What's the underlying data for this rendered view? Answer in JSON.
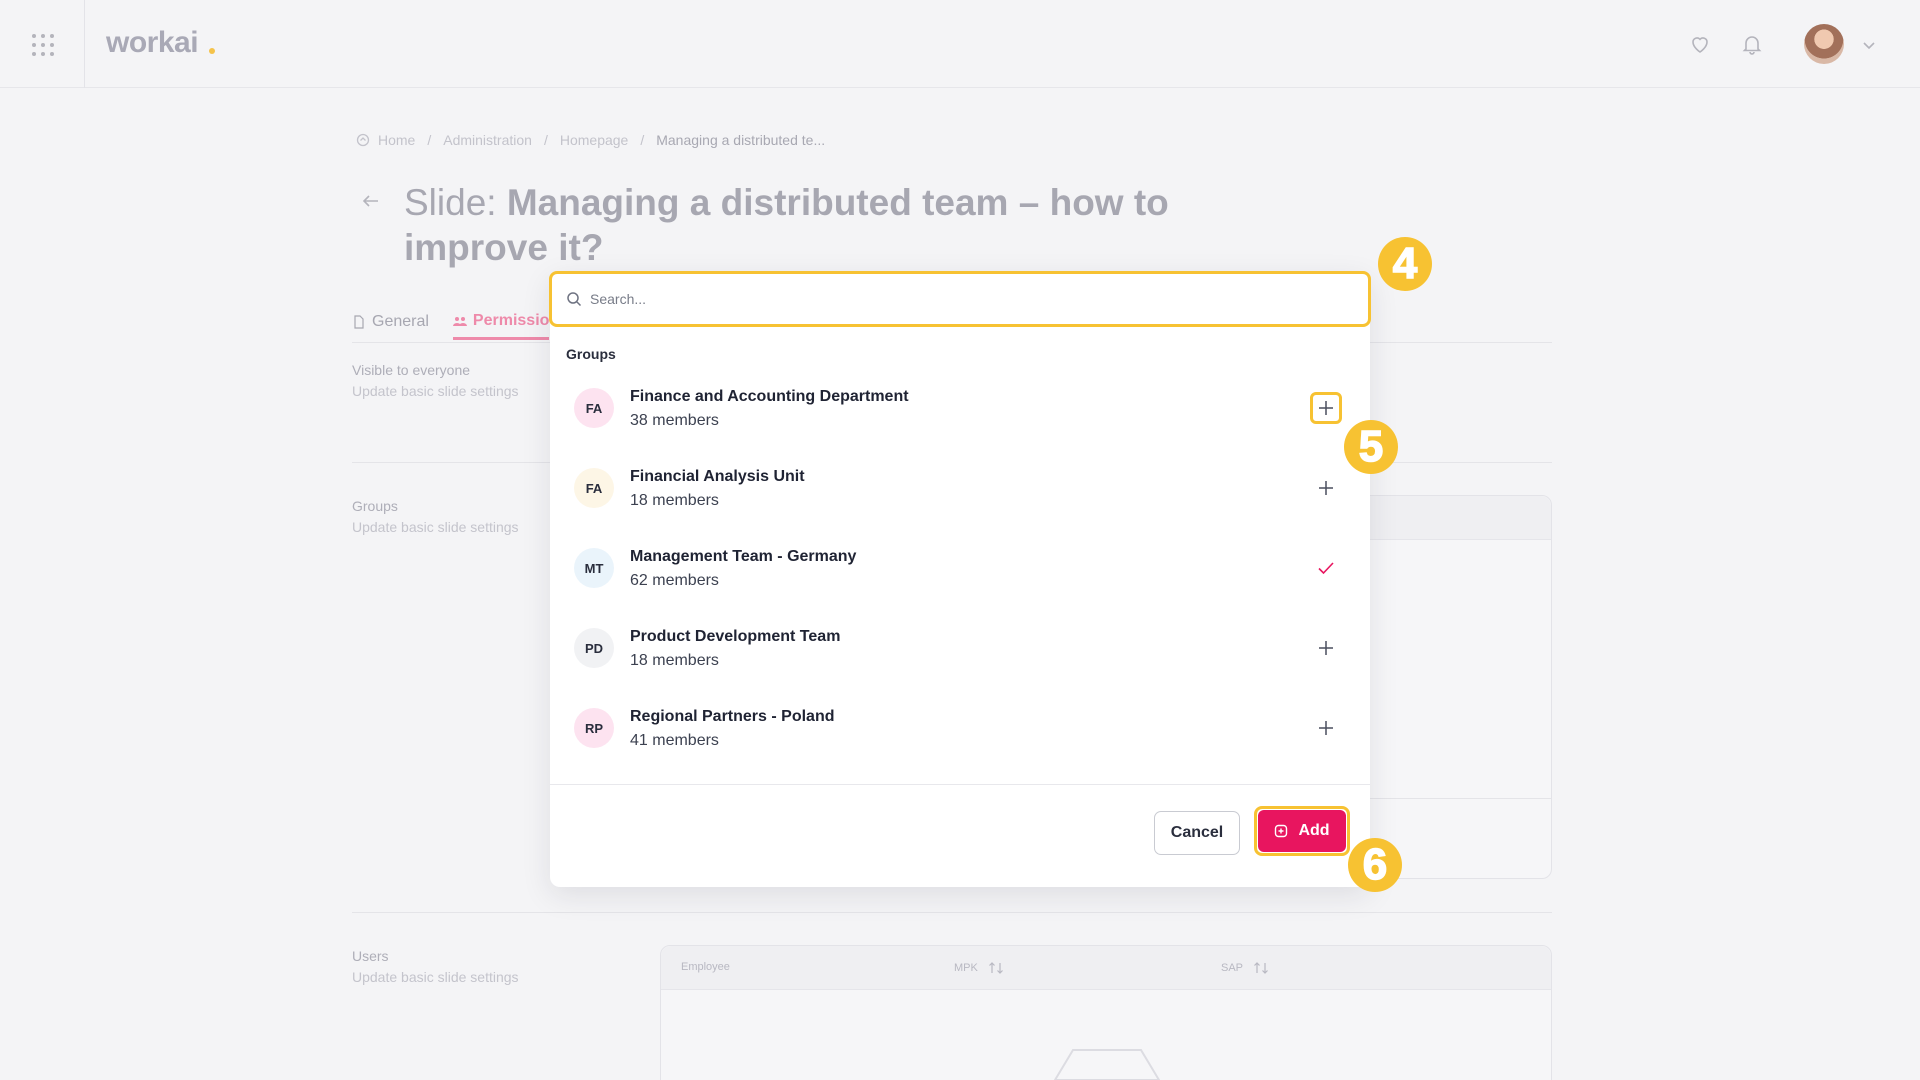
{
  "app": {
    "logo": "workai"
  },
  "breadcrumb": {
    "items": [
      "Home",
      "Administration",
      "Homepage",
      "Managing a distributed te..."
    ],
    "separator": "/"
  },
  "page": {
    "title_prefix": "Slide: ",
    "title_main": "Managing a distributed team – how to improve it?"
  },
  "tabs": [
    {
      "label": "General",
      "active": false
    },
    {
      "label": "Permissio",
      "active": true
    }
  ],
  "sections": {
    "visible": {
      "title": "Visible to everyone",
      "subtitle": "Update basic slide settings"
    },
    "groups": {
      "title": "Groups",
      "subtitle": "Update basic slide settings"
    },
    "users": {
      "title": "Users",
      "subtitle": "Update basic slide settings"
    }
  },
  "users_table": {
    "columns": [
      "Employee",
      "MPK",
      "SAP"
    ]
  },
  "modal": {
    "search": {
      "placeholder": "Search...",
      "value": ""
    },
    "groups_heading": "Groups",
    "groups": [
      {
        "initials": "FA",
        "name": "Finance and Accounting Department",
        "members": "38 members",
        "selected": false,
        "avatar_color": "#fde3f0"
      },
      {
        "initials": "FA",
        "name": "Financial Analysis Unit",
        "members": "18 members",
        "selected": false,
        "avatar_color": "#fdf6e6"
      },
      {
        "initials": "MT",
        "name": "Management Team - Germany",
        "members": "62 members",
        "selected": true,
        "avatar_color": "#eaf4fb"
      },
      {
        "initials": "PD",
        "name": "Product Development Team",
        "members": "18 members",
        "selected": false,
        "avatar_color": "#f1f2f4"
      },
      {
        "initials": "RP",
        "name": "Regional Partners - Poland",
        "members": "41 members",
        "selected": false,
        "avatar_color": "#fde3f0"
      }
    ],
    "cancel_label": "Cancel",
    "add_label": "Add"
  },
  "steps": [
    "4",
    "5",
    "6"
  ],
  "colors": {
    "accent": "#e8155f",
    "highlight": "#f7c232",
    "check": "#e8155f"
  }
}
